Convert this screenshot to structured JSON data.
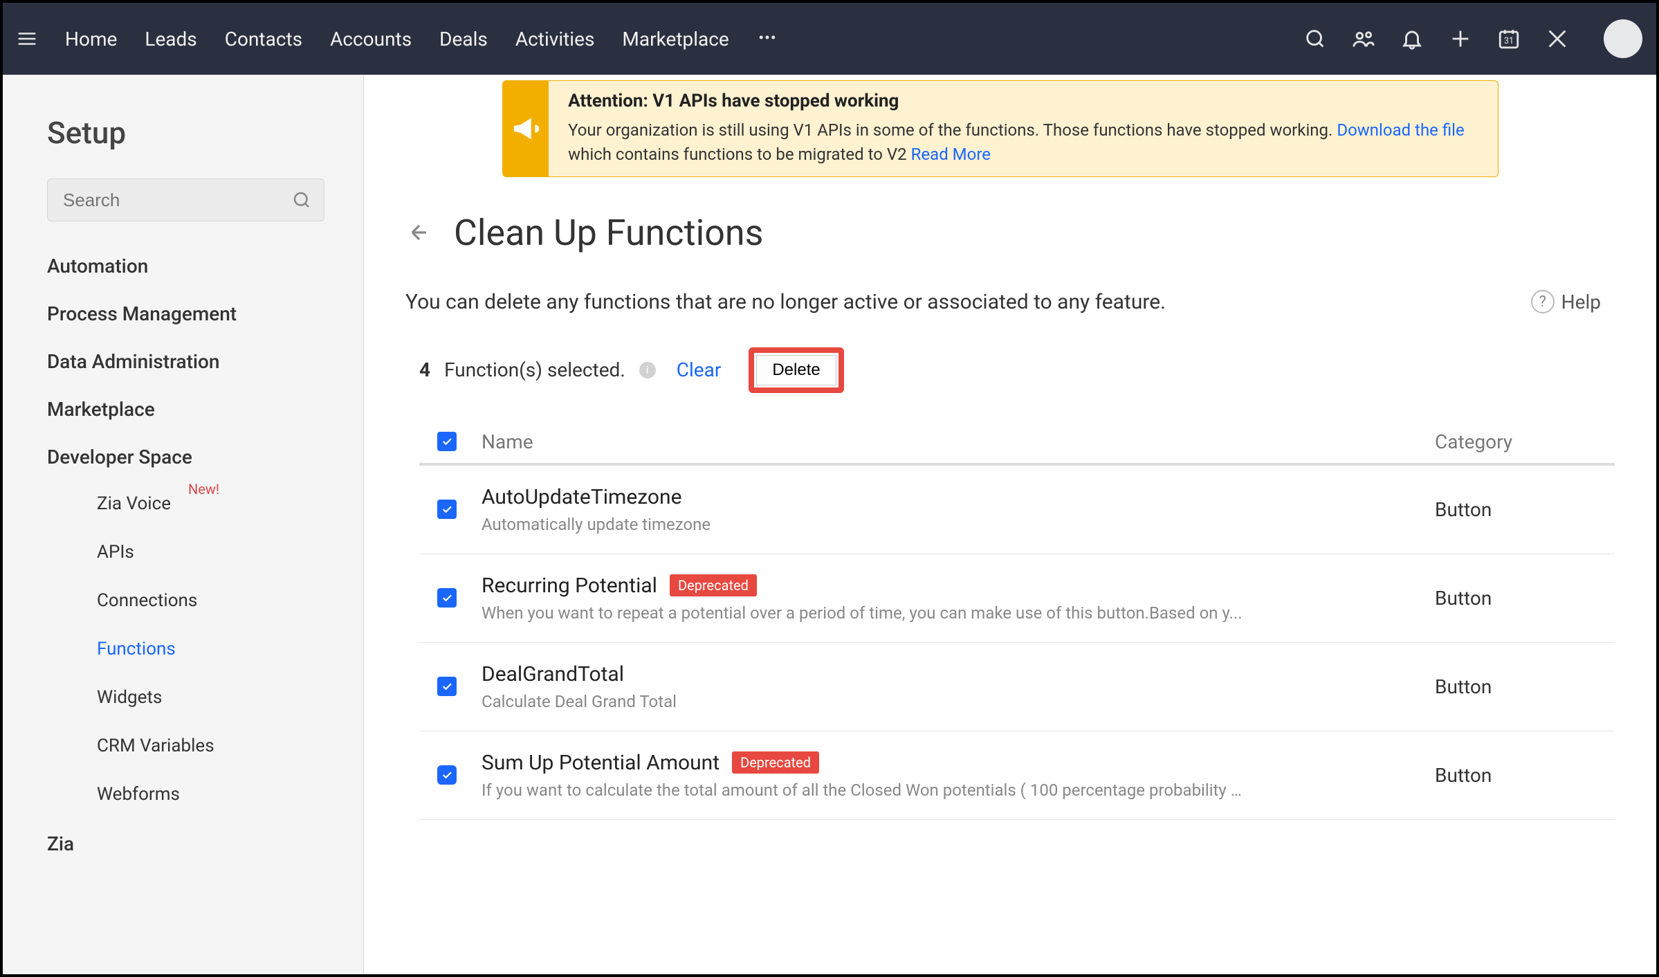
{
  "nav": {
    "items": [
      "Home",
      "Leads",
      "Contacts",
      "Accounts",
      "Deals",
      "Activities",
      "Marketplace"
    ]
  },
  "sidebar": {
    "title": "Setup",
    "search_placeholder": "Search",
    "sections": [
      "Automation",
      "Process Management",
      "Data Administration",
      "Marketplace",
      "Developer Space"
    ],
    "sub_items": [
      "Zia Voice",
      "APIs",
      "Connections",
      "Functions",
      "Widgets",
      "CRM Variables",
      "Webforms"
    ],
    "active_sub": "Functions",
    "new_badge": "New!",
    "tail_section": "Zia"
  },
  "alert": {
    "title": "Attention: V1 APIs have stopped working",
    "body1": "Your organization is still using V1 APIs in some of the functions. Those functions have stopped working. ",
    "link1": "Download the file",
    "body2": " which contains functions to be migrated to V2  ",
    "link2": "Read More"
  },
  "page": {
    "title": "Clean Up Functions",
    "desc": "You can delete any functions that are no longer active or associated to any feature.",
    "help": "Help"
  },
  "selection": {
    "count": "4",
    "label": "Function(s) selected.",
    "clear": "Clear",
    "delete": "Delete"
  },
  "table": {
    "head_name": "Name",
    "head_category": "Category",
    "deprecated_label": "Deprecated",
    "rows": [
      {
        "name": "AutoUpdateTimezone",
        "desc": "Automatically update timezone",
        "category": "Button",
        "deprecated": false,
        "checked": true
      },
      {
        "name": "Recurring Potential",
        "desc": "When you want to repeat a potential over a period of time, you can make use of this button.Based on y...",
        "category": "Button",
        "deprecated": true,
        "checked": true
      },
      {
        "name": "DealGrandTotal",
        "desc": "Calculate Deal Grand Total",
        "category": "Button",
        "deprecated": false,
        "checked": true
      },
      {
        "name": "Sum Up Potential Amount",
        "desc": "If you want to calculate the total amount of all the Closed Won potentials ( 100 percentage probability ) ...",
        "category": "Button",
        "deprecated": true,
        "checked": true
      }
    ]
  }
}
